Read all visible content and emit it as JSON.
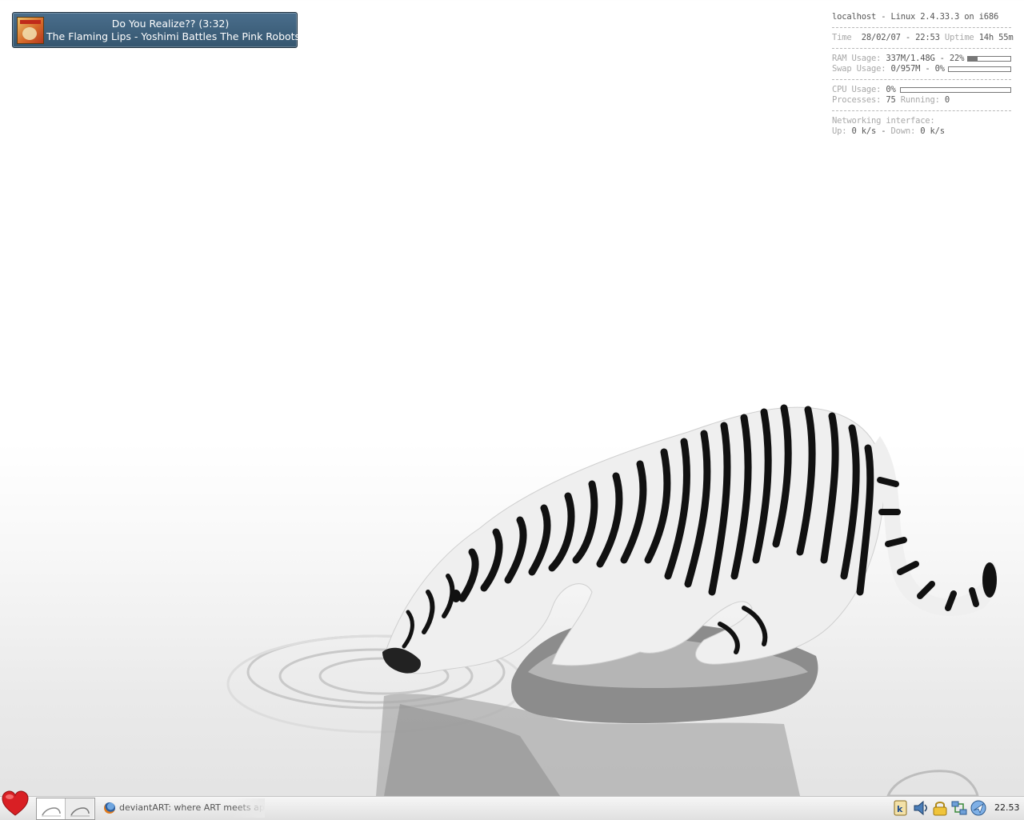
{
  "now_playing": {
    "title": "Do You Realize?? (3:32)",
    "artist_album": "The Flaming Lips - Yoshimi Battles The Pink Robots"
  },
  "conky": {
    "host_line": "localhost - Linux 2.4.33.3 on i686",
    "time_label": "Time",
    "time_value": "28/02/07 - 22:53",
    "uptime_label": "Uptime",
    "uptime_value": "14h 55m",
    "ram_label": "RAM Usage:",
    "ram_value": "337M/1.48G - 22%",
    "ram_fraction": 0.22,
    "swap_label": "Swap Usage:",
    "swap_value": "0/957M - 0%",
    "swap_fraction": 0.0,
    "cpu_label": "CPU Usage:",
    "cpu_value": "0%",
    "cpu_fraction": 0.0,
    "processes_label": "Processes:",
    "processes_value": "75",
    "running_label": "Running:",
    "running_value": "0",
    "net_label": "Networking interface:",
    "up_label": "Up:",
    "up_value": "0 k/s",
    "down_label": "Down:",
    "down_value": "0 k/s"
  },
  "taskbar": {
    "menu_icon": "heart-icon",
    "task_label": "deviantART: where ART meets ap",
    "tray_icons": [
      "kde-icon",
      "volume-icon",
      "lock-icon",
      "network-icon",
      "bird-icon"
    ],
    "clock": "22.53"
  },
  "colors": {
    "popup_bg": "#3f627e",
    "heart": "#d91f24",
    "taskbar": "#e8e8e8"
  }
}
